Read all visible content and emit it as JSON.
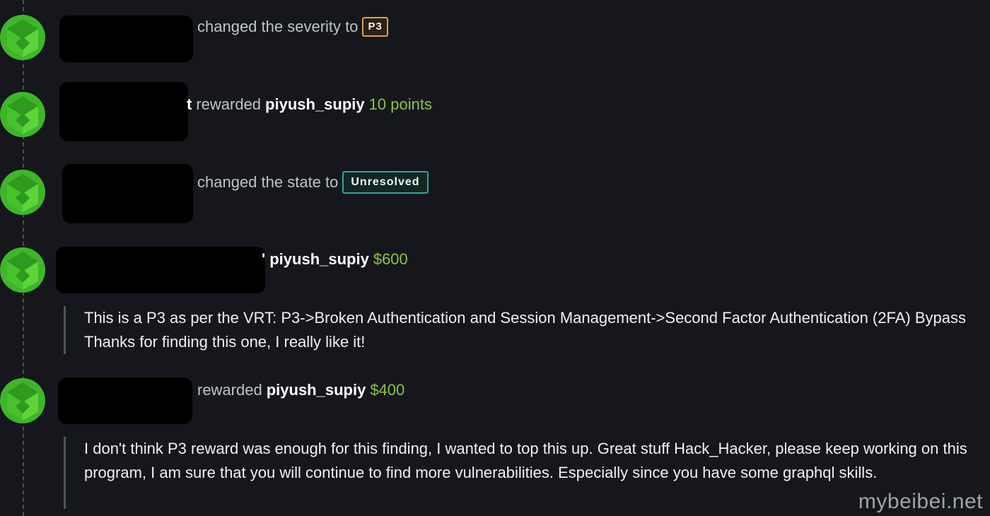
{
  "activity": [
    {
      "type": "severity",
      "action_text": "changed the severity to",
      "badge": "P3"
    },
    {
      "type": "points",
      "name_fragment": "t",
      "action_text": "rewarded",
      "username": "piyush_supiy",
      "amount": "10 points"
    },
    {
      "type": "state",
      "action_text": "changed the state to",
      "badge": "Unresolved"
    },
    {
      "type": "bounty",
      "name_fragment": "'",
      "username": "piyush_supiy",
      "amount": "$600",
      "comment": "This is a P3 as per the VRT: P3->Broken Authentication and Session Management->Second Factor Authentication (2FA) Bypass Thanks for finding this one, I really like it!"
    },
    {
      "type": "bounty",
      "action_text": "rewarded",
      "username": "piyush_supiy",
      "amount": "$400",
      "comment": "I don't think P3 reward was enough for this finding, I wanted to top this up. Great stuff Hack_Hacker, please keep working on this program, I am sure that you will continue to find more vulnerabilities. Especially since you have some graphql skills."
    }
  ],
  "watermark": "mybeibei.net",
  "colors": {
    "background": "#15171c",
    "avatar_green": "#3fb62a",
    "amount_green": "#8dc43f",
    "severity_border": "#d9a24a",
    "state_border": "#2fa59a",
    "redaction": "#000000"
  },
  "icons": {
    "avatar": "green-geometric-avatar-icon"
  }
}
